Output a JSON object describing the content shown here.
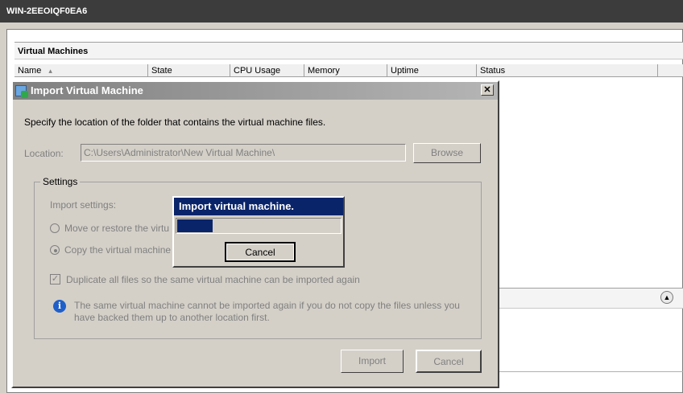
{
  "server": {
    "title": "WIN-2EEOIQF0EA6"
  },
  "vm_pane": {
    "header": "Virtual Machines",
    "columns": [
      "Name",
      "State",
      "CPU Usage",
      "Memory",
      "Uptime",
      "Status"
    ],
    "sort_indicator": "▴"
  },
  "dialog": {
    "title": "Import Virtual Machine",
    "close_glyph": "✕",
    "instruction": "Specify the location of the folder that contains the virtual machine files.",
    "location_label": "Location:",
    "location_value": "C:\\Users\\Administrator\\New Virtual Machine\\",
    "browse_label": "Browse",
    "settings_legend": "Settings",
    "import_settings_label": "Import settings:",
    "option_move": "Move or restore the virtu",
    "option_copy": "Copy the virtual machine",
    "duplicate_label": "Duplicate all files so the same virtual machine can be imported again",
    "info_text": "The same virtual machine cannot be imported again if you do not copy the files unless you have backed them up to another location first.",
    "import_label": "Import",
    "cancel_label": "Cancel"
  },
  "progress": {
    "title": "Import virtual machine.",
    "fraction": 0.22,
    "cancel_label": "Cancel"
  },
  "icons": {
    "info": "i",
    "checkmark": "✓",
    "collapse": "▲"
  }
}
